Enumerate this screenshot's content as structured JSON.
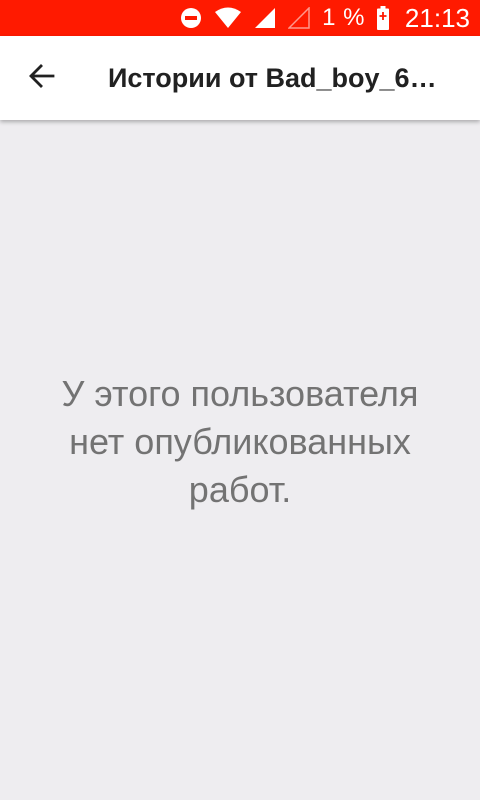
{
  "status_bar": {
    "battery_percent": "1 %",
    "time": "21:13",
    "icons": [
      "do-not-disturb-icon",
      "wifi-icon",
      "signal-icon",
      "no-sim-signal-icon",
      "battery-charging-icon"
    ],
    "color": "#ff1a00"
  },
  "app_bar": {
    "back_icon": "arrow-left-icon",
    "title": "Истории от Bad_boy_6…"
  },
  "main": {
    "empty_message": "У этого пользователя нет опубликованных работ."
  }
}
